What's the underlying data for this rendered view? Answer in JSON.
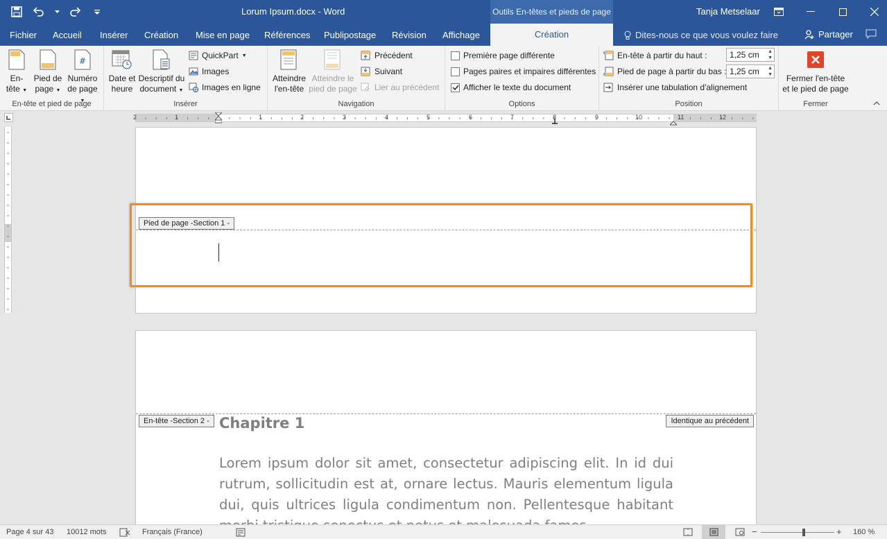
{
  "titlebar": {
    "doc_title": "Lorum Ipsum.docx  -  Word",
    "context_tab_title": "Outils En-têtes et pieds de page",
    "user_name": "Tanja Metselaar"
  },
  "tabs": {
    "items": [
      {
        "label": "Fichier"
      },
      {
        "label": "Accueil"
      },
      {
        "label": "Insérer"
      },
      {
        "label": "Création"
      },
      {
        "label": "Mise en page"
      },
      {
        "label": "Références"
      },
      {
        "label": "Publipostage"
      },
      {
        "label": "Révision"
      },
      {
        "label": "Affichage"
      }
    ],
    "active_label": "Création",
    "tell_me": "Dites-nous ce que vous voulez faire",
    "share": "Partager"
  },
  "ribbon": {
    "group_header_footer": {
      "label": "En-tête et pied de page",
      "header_line1": "En-",
      "header_line2": "tête",
      "footer_line1": "Pied de",
      "footer_line2": "page",
      "number_line1": "Numéro",
      "number_line2": "de page"
    },
    "group_insert": {
      "label": "Insérer",
      "date_line1": "Date et",
      "date_line2": "heure",
      "doc_info_line1": "Descriptif du",
      "doc_info_line2": "document",
      "quickpart": "QuickPart",
      "images": "Images",
      "online_images": "Images en ligne"
    },
    "group_navigation": {
      "label": "Navigation",
      "goto_header_line1": "Atteindre",
      "goto_header_line2": "l'en-tête",
      "goto_footer_line1": "Atteindre le",
      "goto_footer_line2": "pied de page",
      "previous": "Précédent",
      "next": "Suivant",
      "link_previous": "Lier au précédent"
    },
    "group_options": {
      "label": "Options",
      "first_page": "Première page différente",
      "odd_even": "Pages paires et impaires différentes",
      "show_text": "Afficher le texte du document"
    },
    "group_position": {
      "label": "Position",
      "header_from_top": "En-tête à partir du haut :",
      "header_from_top_value": "1,25 cm",
      "footer_from_bottom": "Pied de page à partir du bas :",
      "footer_from_bottom_value": "1,25 cm",
      "insert_tab": "Insérer une tabulation d'alignement"
    },
    "group_close": {
      "label": "Fermer",
      "close_line1": "Fermer l'en-tête",
      "close_line2": "et le pied de page"
    }
  },
  "ruler": {
    "labels": [
      "2",
      "1",
      "1",
      "2",
      "3",
      "4",
      "5",
      "6",
      "7",
      "8",
      "9",
      "10",
      "11",
      "12"
    ]
  },
  "document": {
    "footer_tag": "Pied de page -Section 1 -",
    "header_tag": "En-tête -Section 2 -",
    "same_as_previous": "Identique au précédent",
    "chapter": "Chapitre 1",
    "body": "Lorem ipsum dolor sit amet, consectetur adipiscing elit. In id dui rutrum, sollicitudin est at, ornare lectus. Mauris elementum ligula dui, quis ultrices ligula condimentum non. Pellentesque habitant morbi tristique senectus et netus et malesuada fames"
  },
  "statusbar": {
    "page": "Page 4 sur 43",
    "words": "10012 mots",
    "language": "Français (France)",
    "zoom": "160 %",
    "zoom_minus": "−",
    "zoom_plus": "+"
  },
  "colors": {
    "title_bar": "#2b579a",
    "highlight": "#f08c1e",
    "close_red": "#e0452c"
  }
}
